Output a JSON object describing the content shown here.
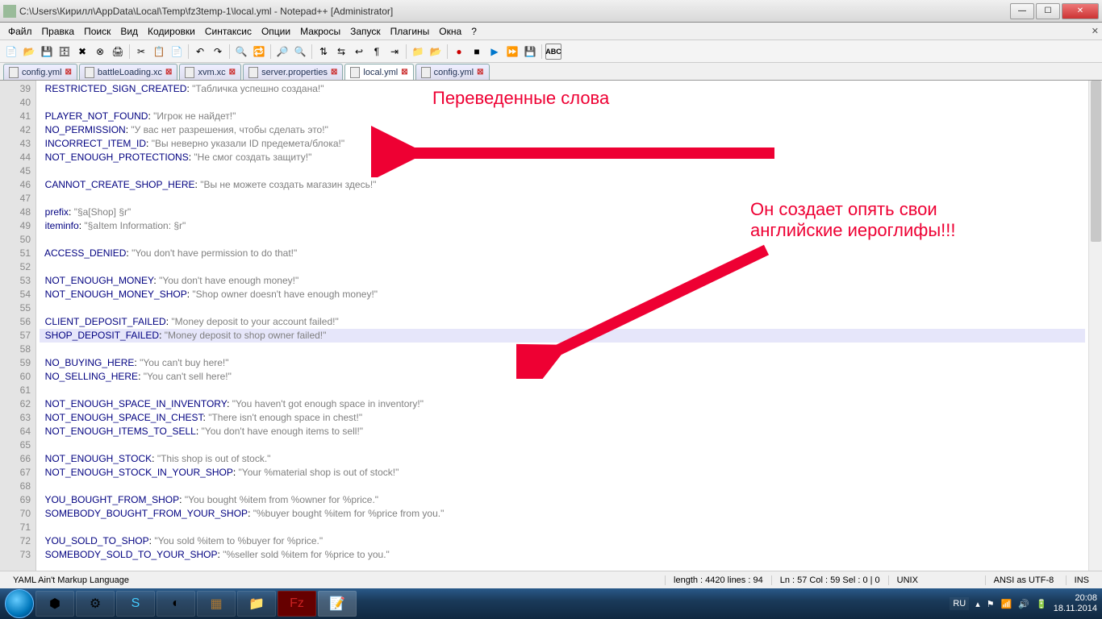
{
  "window": {
    "title": "C:\\Users\\Кирилл\\AppData\\Local\\Temp\\fz3temp-1\\local.yml - Notepad++ [Administrator]"
  },
  "menu": {
    "items": [
      "Файл",
      "Правка",
      "Поиск",
      "Вид",
      "Кодировки",
      "Синтаксис",
      "Опции",
      "Макросы",
      "Запуск",
      "Плагины",
      "Окна",
      "?"
    ]
  },
  "tabs": [
    {
      "label": "config.yml",
      "active": false
    },
    {
      "label": "battleLoading.xc",
      "active": false
    },
    {
      "label": "xvm.xc",
      "active": false
    },
    {
      "label": "server.properties",
      "active": false
    },
    {
      "label": "local.yml",
      "active": true
    },
    {
      "label": "config.yml",
      "active": false
    }
  ],
  "lines": [
    {
      "n": 39,
      "key": "RESTRICTED_SIGN_CREATED",
      "val": "\"Табличка успешно создана!\""
    },
    {
      "n": 40,
      "blank": true
    },
    {
      "n": 41,
      "key": "PLAYER_NOT_FOUND",
      "val": "\"Игрок не найдет!\""
    },
    {
      "n": 42,
      "key": "NO_PERMISSION",
      "val": "\"У вас нет разрешения, чтобы сделать это!\""
    },
    {
      "n": 43,
      "key": "INCORRECT_ITEM_ID",
      "val": "\"Вы неверно указали ID предемета/блока!\""
    },
    {
      "n": 44,
      "key": "NOT_ENOUGH_PROTECTIONS",
      "val": "\"Не смог создать защиту!\""
    },
    {
      "n": 45,
      "blank": true
    },
    {
      "n": 46,
      "key": "CANNOT_CREATE_SHOP_HERE",
      "val": "\"Вы не можете создать магазин здесь!\""
    },
    {
      "n": 47,
      "blank": true
    },
    {
      "n": 48,
      "key": "prefix",
      "val": "\"§a[Shop] §r\""
    },
    {
      "n": 49,
      "key": "iteminfo",
      "val": "\"§aItem Information: §r\""
    },
    {
      "n": 50,
      "blank": true
    },
    {
      "n": 51,
      "key": "ACCESS_DENIED",
      "val": "\"You don't have permission to do that!\""
    },
    {
      "n": 52,
      "blank": true
    },
    {
      "n": 53,
      "key": "NOT_ENOUGH_MONEY",
      "val": "\"You don't have enough money!\""
    },
    {
      "n": 54,
      "key": "NOT_ENOUGH_MONEY_SHOP",
      "val": "\"Shop owner doesn't have enough money!\""
    },
    {
      "n": 55,
      "blank": true
    },
    {
      "n": 56,
      "key": "CLIENT_DEPOSIT_FAILED",
      "val": "\"Money deposit to your account failed!\""
    },
    {
      "n": 57,
      "key": "SHOP_DEPOSIT_FAILED",
      "val": "\"Money deposit to shop owner failed!\"",
      "hl": true
    },
    {
      "n": 58,
      "blank": true
    },
    {
      "n": 59,
      "key": "NO_BUYING_HERE",
      "val": "\"You can't buy here!\""
    },
    {
      "n": 60,
      "key": "NO_SELLING_HERE",
      "val": "\"You can't sell here!\""
    },
    {
      "n": 61,
      "blank": true
    },
    {
      "n": 62,
      "key": "NOT_ENOUGH_SPACE_IN_INVENTORY",
      "val": "\"You haven't got enough space in inventory!\""
    },
    {
      "n": 63,
      "key": "NOT_ENOUGH_SPACE_IN_CHEST",
      "val": "\"There isn't enough space in chest!\""
    },
    {
      "n": 64,
      "key": "NOT_ENOUGH_ITEMS_TO_SELL",
      "val": "\"You don't have enough items to sell!\""
    },
    {
      "n": 65,
      "blank": true
    },
    {
      "n": 66,
      "key": "NOT_ENOUGH_STOCK",
      "val": "\"This shop is out of stock.\""
    },
    {
      "n": 67,
      "key": "NOT_ENOUGH_STOCK_IN_YOUR_SHOP",
      "val": "\"Your %material shop is out of stock!\""
    },
    {
      "n": 68,
      "blank": true
    },
    {
      "n": 69,
      "key": "YOU_BOUGHT_FROM_SHOP",
      "val": "\"You bought %item from %owner for %price.\""
    },
    {
      "n": 70,
      "key": "SOMEBODY_BOUGHT_FROM_YOUR_SHOP",
      "val": "\"%buyer bought %item for %price from you.\""
    },
    {
      "n": 71,
      "blank": true
    },
    {
      "n": 72,
      "key": "YOU_SOLD_TO_SHOP",
      "val": "\"You sold %item to %buyer for %price.\""
    },
    {
      "n": 73,
      "key": "SOMEBODY_SOLD_TO_YOUR_SHOP",
      "val": "\"%seller sold %item for %price to you.\""
    }
  ],
  "status": {
    "lang": "YAML Ain't Markup Language",
    "length": "length : 4420    lines : 94",
    "pos": "Ln : 57    Col : 59    Sel : 0 | 0",
    "eol": "UNIX",
    "enc": "ANSI as UTF-8",
    "ins": "INS"
  },
  "annotations": {
    "text1": "Переведенные слова",
    "text2_l1": "Он создает опять свои",
    "text2_l2": "английские иероглифы!!!"
  },
  "tray": {
    "lang": "RU",
    "time": "20:08",
    "date": "18.11.2014"
  }
}
